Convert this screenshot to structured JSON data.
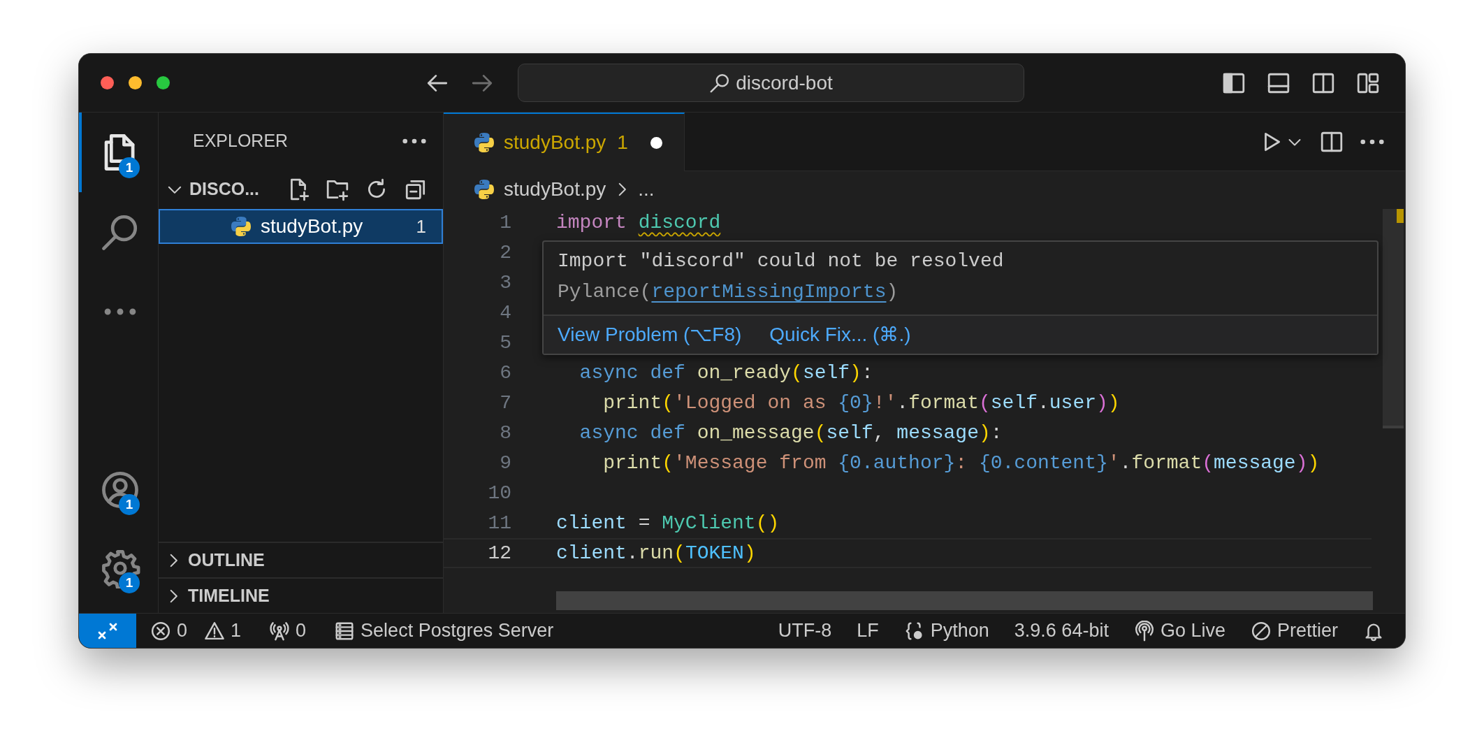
{
  "window": {
    "search": "discord-bot"
  },
  "activity_bar": [
    {
      "kind": "explorer",
      "selected": true,
      "badge": "1"
    },
    {
      "kind": "search",
      "selected": false
    },
    {
      "kind": "more",
      "selected": false
    }
  ],
  "activity_bar_bottom": [
    {
      "kind": "account",
      "badge": "1"
    },
    {
      "kind": "settings",
      "badge": "1"
    }
  ],
  "sidebar": {
    "title": "EXPLORER",
    "folder": {
      "name": "DISCO...",
      "expanded": true,
      "files": [
        {
          "name": "studyBot.py",
          "problems": "1",
          "selected": true
        }
      ]
    },
    "sections": [
      {
        "label": "OUTLINE",
        "expanded": false
      },
      {
        "label": "TIMELINE",
        "expanded": false
      }
    ]
  },
  "tabs": [
    {
      "label": "studyBot.py",
      "problems": "1",
      "modified": true,
      "selected": true
    }
  ],
  "breadcrumbs": {
    "file": "studyBot.py",
    "more": "..."
  },
  "editor": {
    "lines": [
      {
        "number": "1",
        "current": false,
        "tokens": [
          {
            "text": "import ",
            "kind": "keyword"
          },
          {
            "text": "discord",
            "kind": "class",
            "error": true
          }
        ]
      },
      {
        "number": "2",
        "current": false
      },
      {
        "number": "3",
        "current": false
      },
      {
        "number": "4",
        "current": false
      },
      {
        "number": "5",
        "current": false
      },
      {
        "number": "6",
        "current": false,
        "tokens": [
          {
            "text": "  async",
            "kind": "storage"
          },
          {
            "text": " def",
            "kind": "storage"
          },
          {
            "text": " on_ready",
            "kind": "function"
          },
          {
            "text": "(",
            "kind": "bracket1"
          },
          {
            "text": "self",
            "kind": "variable"
          },
          {
            "text": ")",
            "kind": "bracket1"
          },
          {
            "text": ":",
            "kind": "plain"
          }
        ]
      },
      {
        "number": "7",
        "current": false,
        "tokens": [
          {
            "text": "    print",
            "kind": "function"
          },
          {
            "text": "(",
            "kind": "bracket1"
          },
          {
            "text": "'Logged on as ",
            "kind": "string"
          },
          {
            "text": "{0}",
            "kind": "placeholder"
          },
          {
            "text": "!'",
            "kind": "string"
          },
          {
            "text": ".",
            "kind": "plain"
          },
          {
            "text": "format",
            "kind": "function"
          },
          {
            "text": "(",
            "kind": "bracket2"
          },
          {
            "text": "self",
            "kind": "variable"
          },
          {
            "text": ".",
            "kind": "plain"
          },
          {
            "text": "user",
            "kind": "variable"
          },
          {
            "text": ")",
            "kind": "bracket2"
          },
          {
            "text": ")",
            "kind": "bracket1"
          }
        ]
      },
      {
        "number": "8",
        "current": false,
        "tokens": [
          {
            "text": "  async",
            "kind": "storage"
          },
          {
            "text": " def",
            "kind": "storage"
          },
          {
            "text": " on_message",
            "kind": "function"
          },
          {
            "text": "(",
            "kind": "bracket1"
          },
          {
            "text": "self",
            "kind": "variable"
          },
          {
            "text": ",",
            "kind": "plain"
          },
          {
            "text": " message",
            "kind": "variable"
          },
          {
            "text": ")",
            "kind": "bracket1"
          },
          {
            "text": ":",
            "kind": "plain"
          }
        ]
      },
      {
        "number": "9",
        "current": false,
        "tokens": [
          {
            "text": "    print",
            "kind": "function"
          },
          {
            "text": "(",
            "kind": "bracket1"
          },
          {
            "text": "'Message from ",
            "kind": "string"
          },
          {
            "text": "{0.author}",
            "kind": "placeholder"
          },
          {
            "text": ": ",
            "kind": "string"
          },
          {
            "text": "{0.content}",
            "kind": "placeholder"
          },
          {
            "text": "'",
            "kind": "string"
          },
          {
            "text": ".",
            "kind": "plain"
          },
          {
            "text": "format",
            "kind": "function"
          },
          {
            "text": "(",
            "kind": "bracket2"
          },
          {
            "text": "message",
            "kind": "variable"
          },
          {
            "text": ")",
            "kind": "bracket2"
          },
          {
            "text": ")",
            "kind": "bracket1"
          }
        ]
      },
      {
        "number": "10",
        "current": false
      },
      {
        "number": "11",
        "current": false,
        "tokens": [
          {
            "text": "client",
            "kind": "variable"
          },
          {
            "text": " = ",
            "kind": "plain"
          },
          {
            "text": "MyClient",
            "kind": "class"
          },
          {
            "text": "(",
            "kind": "bracket1"
          },
          {
            "text": ")",
            "kind": "bracket1"
          }
        ]
      },
      {
        "number": "12",
        "current": true,
        "tokens": [
          {
            "text": "client",
            "kind": "variable"
          },
          {
            "text": ".",
            "kind": "plain"
          },
          {
            "text": "run",
            "kind": "function"
          },
          {
            "text": "(",
            "kind": "bracket1"
          },
          {
            "text": "TOKEN",
            "kind": "constant"
          },
          {
            "text": ")",
            "kind": "bracket1"
          }
        ]
      }
    ]
  },
  "hover": {
    "message": "Import \"discord\" could not be resolved",
    "source": "Pylance(",
    "code": "reportMissingImports",
    "source_end": ")",
    "actions": [
      {
        "label": "View Problem (⌥F8)"
      },
      {
        "label": "Quick Fix... (⌘.)"
      }
    ]
  },
  "status_bar": {
    "left": [
      {
        "kind": "errors",
        "text": "0"
      },
      {
        "kind": "warnings",
        "text": "1"
      },
      {
        "kind": "ports",
        "text": "0"
      },
      {
        "kind": "database",
        "text": "Select Postgres Server"
      }
    ],
    "right": [
      {
        "kind": "text",
        "text": "UTF-8"
      },
      {
        "kind": "text",
        "text": "LF"
      },
      {
        "kind": "language",
        "text": "Python"
      },
      {
        "kind": "text",
        "text": "3.9.6 64-bit"
      },
      {
        "kind": "live",
        "text": "Go Live"
      },
      {
        "kind": "prettier",
        "text": "Prettier"
      },
      {
        "kind": "bell"
      }
    ]
  }
}
